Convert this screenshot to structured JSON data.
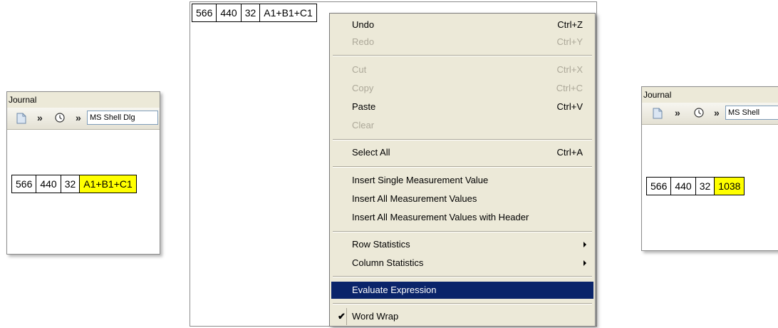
{
  "left": {
    "title": "Journal",
    "font": "MS Shell Dlg",
    "cells": [
      "566",
      "440",
      "32",
      "A1+B1+C1"
    ]
  },
  "middle": {
    "cells": [
      "566",
      "440",
      "32",
      "A1+B1+C1"
    ]
  },
  "menu": {
    "undo": {
      "label": "Undo",
      "shortcut": "Ctrl+Z"
    },
    "redo": {
      "label": "Redo",
      "shortcut": "Ctrl+Y"
    },
    "cut": {
      "label": "Cut",
      "shortcut": "Ctrl+X"
    },
    "copy": {
      "label": "Copy",
      "shortcut": "Ctrl+C"
    },
    "paste": {
      "label": "Paste",
      "shortcut": "Ctrl+V"
    },
    "clear": {
      "label": "Clear"
    },
    "select_all": {
      "label": "Select All",
      "shortcut": "Ctrl+A"
    },
    "insert_single": {
      "label": "Insert Single Measurement Value"
    },
    "insert_all": {
      "label": "Insert All Measurement Values"
    },
    "insert_all_header": {
      "label": "Insert All Measurement Values with Header"
    },
    "row_stats": {
      "label": "Row Statistics"
    },
    "col_stats": {
      "label": "Column Statistics"
    },
    "evaluate": {
      "label": "Evaluate Expression"
    },
    "word_wrap": {
      "label": "Word Wrap",
      "checked": true
    }
  },
  "right": {
    "title": "Journal",
    "font": "MS Shell",
    "cells": [
      "566",
      "440",
      "32",
      "1038"
    ]
  },
  "colors": {
    "highlight": "#ffff00",
    "menu_selection": "#0a246a",
    "menu_background": "#ece9d8"
  }
}
